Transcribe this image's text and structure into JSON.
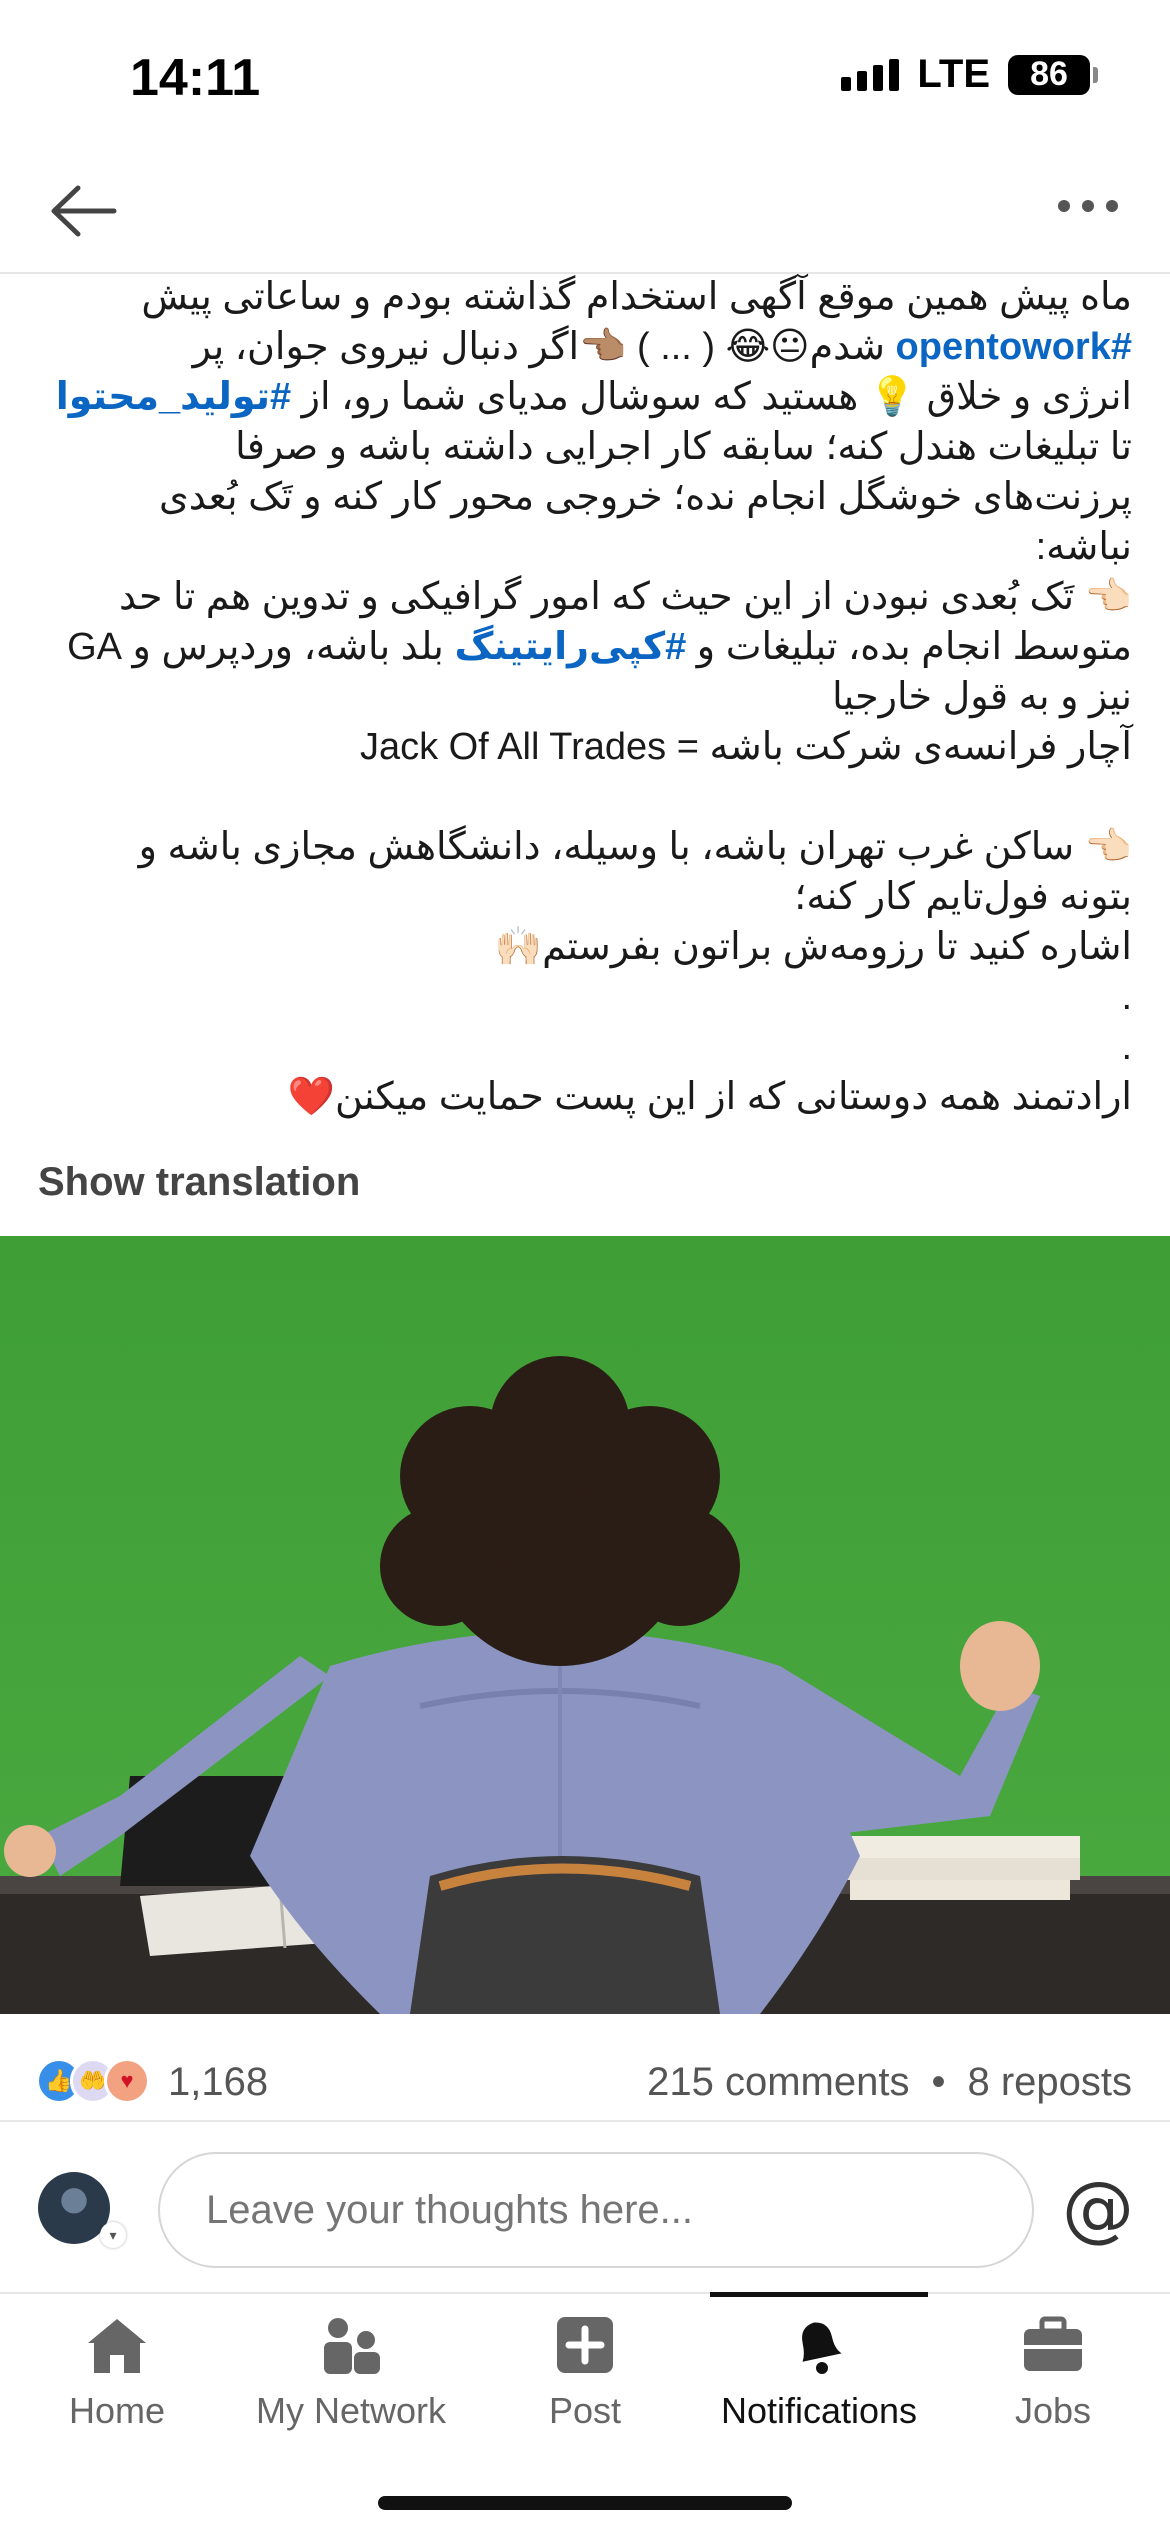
{
  "status_bar": {
    "time": "14:11",
    "network": "LTE",
    "battery": "86"
  },
  "post": {
    "lines": [
      "ماه پیش همین موقع آگهی استخدام گذاشته بودم و ساعاتی پیش",
      "",
      "انرژی و خلاق 💡 هستید که سوشال مدیای شما رو، از ",
      "تا تبلیغات هندل کنه؛ سابقه کار اجرایی داشته باشه و صرفا",
      "پرزنت‌های خوشگل انجام نده؛ خروجی محور کار کنه و تَک بُعدی",
      "نباشه:",
      "👈🏻 تَک بُعدی نبودن از این حیث که امور گرافیکی و تدوین هم تا حد",
      "",
      "نیز و به قول خارجیا",
      "آچار فرانسه‌ی شرکت باشه = Jack Of All Trades",
      "",
      "👈🏻 ساکن غرب تهران باشه، با وسیله، دانشگاهش مجازی باشه و",
      "بتونه فول‌تایم کار کنه؛",
      "اشاره کنید تا رزومه‌ش براتون بفرستم🙌🏻",
      ".",
      ".",
      "ارادتمند همه دوستانی که از این پست حمایت میکنن❤️"
    ],
    "line2_tag": "#opentowork",
    "line2_rest": " شدم😐😂 ( ... ) 👈🏽اگر دنبال نیروی جوان، پر",
    "line3_tag": "#تولید_محتوا",
    "line8_pre": "متوسط انجام بده، تبلیغات و ",
    "line8_tag": "#کپی‌رایتینگ",
    "line8_post": " بلد باشه، وردپرس و GA",
    "show_translation": "Show translation"
  },
  "stats": {
    "reactions_count": "1,168",
    "comments": "215 comments",
    "separator": "•",
    "reposts": "8 reposts"
  },
  "comment_bar": {
    "placeholder": "Leave your thoughts here...",
    "mention_symbol": "@"
  },
  "tabs": [
    {
      "label": "Home",
      "icon": "home-icon"
    },
    {
      "label": "My Network",
      "icon": "network-icon"
    },
    {
      "label": "Post",
      "icon": "post-plus-icon"
    },
    {
      "label": "Notifications",
      "icon": "bell-icon"
    },
    {
      "label": "Jobs",
      "icon": "briefcase-icon"
    }
  ],
  "colors": {
    "link": "#0a66c2",
    "green_screen": "#46a63c"
  }
}
